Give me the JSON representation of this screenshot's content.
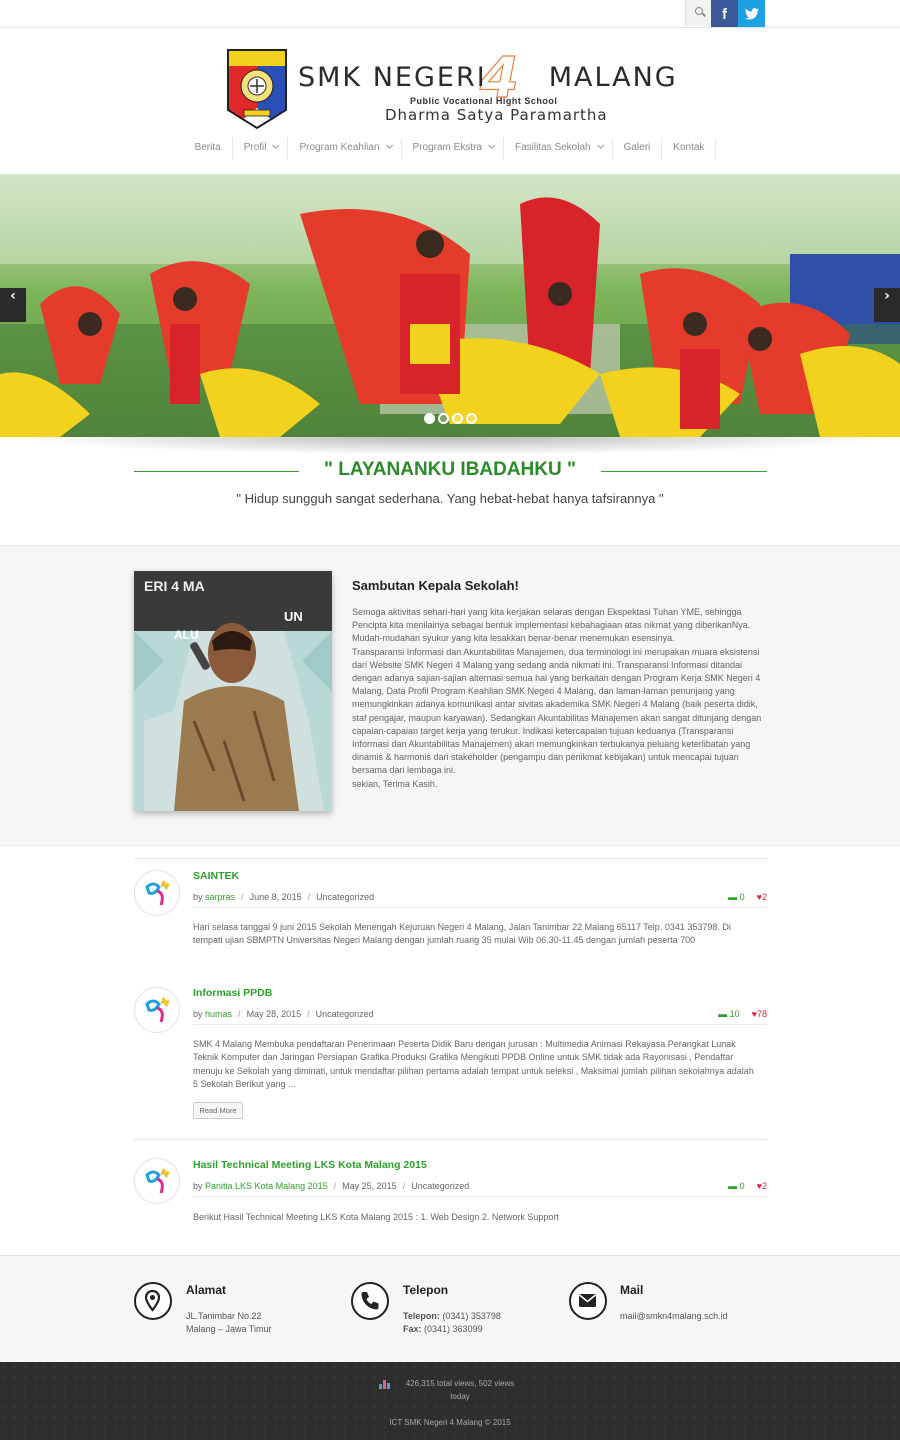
{
  "topbar": {
    "search_icon": "search-icon",
    "facebook_label": "f",
    "twitter_icon": "twitter-icon"
  },
  "brand": {
    "name_part1": "SMK NEGERI",
    "name_number": "4",
    "name_part2": "MALANG",
    "subtitle": "Public Vocational Hight School",
    "motto": "Dharma Satya Paramartha"
  },
  "nav": {
    "items": [
      {
        "label": "Berita"
      },
      {
        "label": "Profil"
      },
      {
        "label": "Program Keahlian"
      },
      {
        "label": "Program Ekstra"
      },
      {
        "label": "Fasilitas Sekolah"
      },
      {
        "label": "Galeri"
      },
      {
        "label": "Kontak"
      }
    ]
  },
  "slider": {
    "prev_label": "‹",
    "next_label": "›",
    "slide_count": 4,
    "active_slide": 1
  },
  "tagline": {
    "title": "\" LAYANANKU IBADAHKU \"",
    "subtitle": "\" Hidup sungguh sangat sederhana. Yang hebat-hebat hanya tafsirannya \""
  },
  "welcome": {
    "title": "Sambutan Kepala Sekolah!",
    "body": "Semoga aktivitas sehari-hari yang kita kerjakan selaras dengan Ekspektasi Tuhan YME, sehingga Pencipta kita menilainya sebagai bentuk implementasi kebahagiaan atas nikmat yang diberikanNya. Mudah-mudahan syukur yang kita lesakkan benar-benar menemukan esensinya.",
    "body2": "Transparansi Informasi dan Akuntabilitas Manajemen, dua terminologi ini merupakan muara eksistensi dari Website SMK Negeri 4 Malang yang sedang anda nikmati ini. Transparansi Informasi ditandai dengan adanya sajian-sajian alternasi semua hal yang berkaitan dengan Program Kerja SMK Negeri 4 Malang, Data Profil Program Keahlian SMK Negeri 4 Malang, dan laman-laman penunjang yang memungkinkan adanya komunikasi antar sivitas akademika SMK Negeri 4 Malang (baik peserta didik, staf pengajar, maupun karyawan). Sedangkan Akuntabilitas Manajemen akan sangat ditunjang dengan capaian-capaian target kerja yang terukur. Indikasi ketercapaian tujuan keduanya (Transparansi Informasi dan Akuntabilitas Manajemen) akan memungkinkan terbukanya peluang keterlibatan yang dinamis & harmonis dari stakeholder (pengampu dan penikmat kebijakan) untuk mencapai tujuan bersama dari lembaga ini.",
    "closing": "sekian, Terima Kasih."
  },
  "posts": [
    {
      "title": "SAINTEK",
      "by": "by",
      "author": "sarpras",
      "date": "June 8, 2015",
      "category": "Uncategorized",
      "comments": "0",
      "likes": "2",
      "excerpt": "Hari selasa tanggal 9 juni 2015 Sekolah Menengah Kejuruan Negeri 4 Malang, Jalan Tanimbar 22 Malang 65117 Telp. 0341 353798. Di tempati ujian SBMPTN Universitas Negeri Malang dengan jumlah ruang 35 mulai Wib 06.30-11.45 dengan jumlah peserta 700"
    },
    {
      "title": "Informasi PPDB",
      "by": "by",
      "author": "humas",
      "date": "May 28, 2015",
      "category": "Uncategorized",
      "comments": "10",
      "likes": "78",
      "excerpt": "SMK 4 Malang Membuka pendaftaran Penerimaan Peserta Didik Baru dengan jurusan : Multimedia Animasi Rekayasa Perangkat Lunak Teknik Komputer dan Jaringan Persiapan Grafika Produksi Grafika Mengikuti PPDB Online untuk SMK tidak ada Rayonisasi , Pendaftar menuju ke Sekolah yang diminati, untuk mendaftar pilihan pertama adalah tempat untuk seleksi , Maksimal jumlah pilihan sekolahnya adalah  5 Sekolah   Berikut yang ...",
      "read_more": "Read More"
    },
    {
      "title": "Hasil Technical Meeting LKS Kota Malang 2015",
      "by": "by",
      "author": "Panitia LKS Kota Malang 2015",
      "date": "May 25, 2015",
      "category": "Uncategorized",
      "comments": "0",
      "likes": "2",
      "excerpt": "Berikut Hasil Technical Meeting LKS Kota Malang 2015 : 1. Web Design 2. Network Support"
    }
  ],
  "contact": {
    "address": {
      "title": "Alamat",
      "line1": "JL.Tanimbar No.22",
      "line2": "Malang – Jawa Timur"
    },
    "phone": {
      "title": "Telepon",
      "label1": "Telepon:",
      "value1": "(0341) 353798",
      "label2": "Fax:",
      "value2": "(0341) 363099"
    },
    "mail": {
      "title": "Mail",
      "email": "mail@smkn4malang.sch.id"
    }
  },
  "footer": {
    "stats": "426,315 total views, 502 views today",
    "copyright": "ICT SMK Negeri 4 Malang © 2015"
  },
  "colors": {
    "accent_green": "#2ea02e",
    "like_red": "#e0203a",
    "facebook": "#3b5998",
    "twitter": "#1da1e2",
    "footer_bg": "#2e2e2e"
  }
}
